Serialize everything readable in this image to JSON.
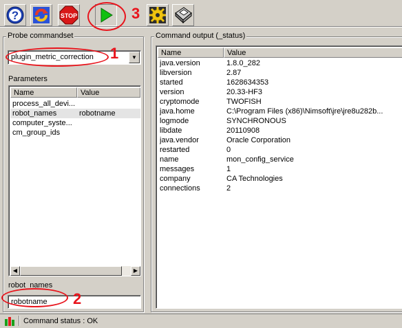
{
  "toolbar": {
    "buttons": [
      {
        "icon": "help-icon"
      },
      {
        "icon": "refresh-icon"
      },
      {
        "icon": "stop-icon",
        "label": "STOP"
      },
      {
        "icon": "run-icon"
      },
      {
        "icon": "settings-icon"
      },
      {
        "icon": "save-icon"
      }
    ]
  },
  "probe_commandset": {
    "label": "Probe commandset",
    "selected": "plugin_metric_correction"
  },
  "parameters": {
    "label": "Parameters",
    "columns": [
      "Name",
      "Value"
    ],
    "rows": [
      {
        "name": "process_all_devi...",
        "value": ""
      },
      {
        "name": "robot_names",
        "value": "robotname",
        "selected": true
      },
      {
        "name": "computer_syste...",
        "value": ""
      },
      {
        "name": "cm_group_ids",
        "value": ""
      }
    ]
  },
  "param_edit": {
    "label": "robot_names",
    "value": "robotname"
  },
  "output": {
    "label": "Command output (_status)",
    "columns": [
      "Name",
      "Value"
    ],
    "rows": [
      {
        "name": "java.version",
        "value": "1.8.0_282"
      },
      {
        "name": "libversion",
        "value": "2.87"
      },
      {
        "name": "started",
        "value": "1628634353"
      },
      {
        "name": "version",
        "value": "20.33-HF3"
      },
      {
        "name": "cryptomode",
        "value": "TWOFISH"
      },
      {
        "name": "java.home",
        "value": "C:\\Program Files (x86)\\Nimsoft\\jre\\jre8u282b..."
      },
      {
        "name": "logmode",
        "value": "SYNCHRONOUS"
      },
      {
        "name": "libdate",
        "value": "20110908"
      },
      {
        "name": "java.vendor",
        "value": "Oracle Corporation"
      },
      {
        "name": "restarted",
        "value": "0"
      },
      {
        "name": "name",
        "value": "mon_config_service"
      },
      {
        "name": "messages",
        "value": "1"
      },
      {
        "name": "company",
        "value": "CA Technologies"
      },
      {
        "name": "connections",
        "value": "2"
      }
    ]
  },
  "status": {
    "text": "Command status : OK"
  },
  "annotations": {
    "marks": [
      "1",
      "2",
      "3"
    ],
    "color": "#e8141c"
  }
}
